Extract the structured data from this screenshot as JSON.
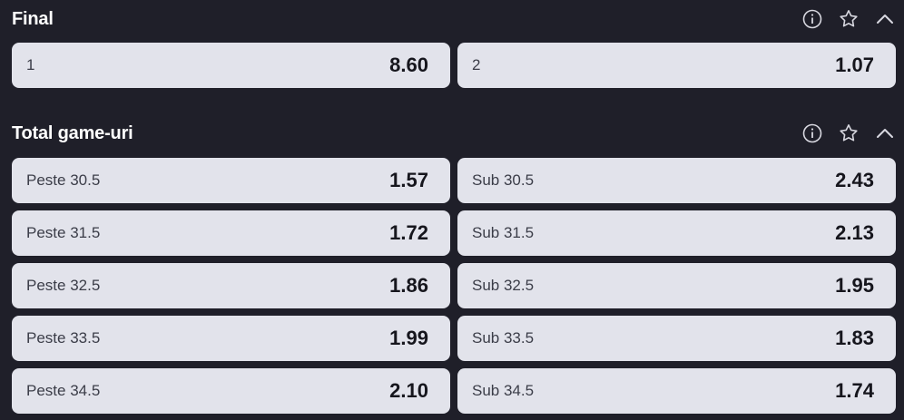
{
  "markets": [
    {
      "title": "Final",
      "rows": [
        [
          {
            "label": "1",
            "odd": "8.60"
          },
          {
            "label": "2",
            "odd": "1.07"
          }
        ]
      ]
    },
    {
      "title": "Total game-uri",
      "rows": [
        [
          {
            "label": "Peste 30.5",
            "odd": "1.57"
          },
          {
            "label": "Sub 30.5",
            "odd": "2.43"
          }
        ],
        [
          {
            "label": "Peste 31.5",
            "odd": "1.72"
          },
          {
            "label": "Sub 31.5",
            "odd": "2.13"
          }
        ],
        [
          {
            "label": "Peste 32.5",
            "odd": "1.86"
          },
          {
            "label": "Sub 32.5",
            "odd": "1.95"
          }
        ],
        [
          {
            "label": "Peste 33.5",
            "odd": "1.99"
          },
          {
            "label": "Sub 33.5",
            "odd": "1.83"
          }
        ],
        [
          {
            "label": "Peste 34.5",
            "odd": "2.10"
          },
          {
            "label": "Sub 34.5",
            "odd": "1.74"
          }
        ]
      ]
    }
  ],
  "icons": {
    "info": "info-icon",
    "favorite": "star-icon",
    "collapse": "chevron-up-icon"
  },
  "colors": {
    "background": "#1f1f29",
    "cell": "#e2e3eb",
    "title": "#ffffff",
    "odd": "#16161d"
  }
}
